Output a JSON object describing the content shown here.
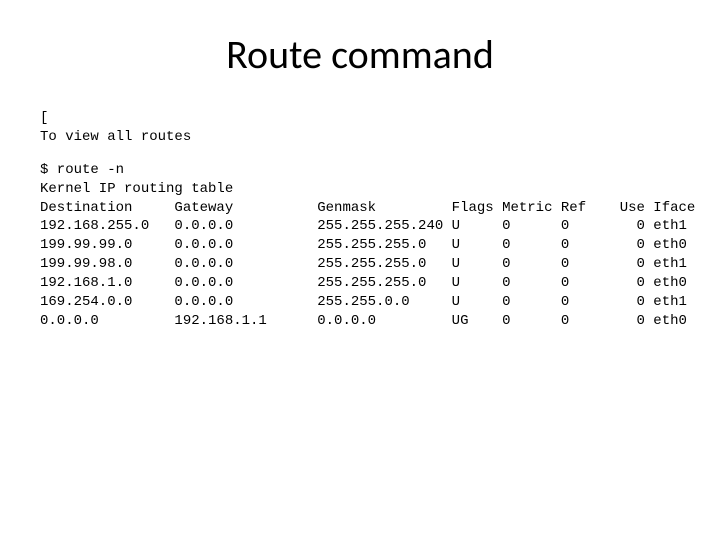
{
  "title": "Route command",
  "intro_bracket": "[",
  "intro_line": "To view all routes",
  "command": "$ route -n",
  "table_title": "Kernel IP routing table",
  "columns": {
    "dest": "Destination",
    "gw": "Gateway",
    "gen": "Genmask",
    "flags": "Flags",
    "metric": "Metric",
    "ref": "Ref",
    "use": "Use",
    "iface": "Iface"
  },
  "rows": [
    {
      "dest": "192.168.255.0",
      "gw": "0.0.0.0",
      "gen": "255.255.255.240",
      "flags": "U",
      "metric": "0",
      "ref": "0",
      "use": "0",
      "iface": "eth1"
    },
    {
      "dest": "199.99.99.0",
      "gw": "0.0.0.0",
      "gen": "255.255.255.0",
      "flags": "U",
      "metric": "0",
      "ref": "0",
      "use": "0",
      "iface": "eth0"
    },
    {
      "dest": "199.99.98.0",
      "gw": "0.0.0.0",
      "gen": "255.255.255.0",
      "flags": "U",
      "metric": "0",
      "ref": "0",
      "use": "0",
      "iface": "eth1"
    },
    {
      "dest": "192.168.1.0",
      "gw": "0.0.0.0",
      "gen": "255.255.255.0",
      "flags": "U",
      "metric": "0",
      "ref": "0",
      "use": "0",
      "iface": "eth0"
    },
    {
      "dest": "169.254.0.0",
      "gw": "0.0.0.0",
      "gen": "255.255.0.0",
      "flags": "U",
      "metric": "0",
      "ref": "0",
      "use": "0",
      "iface": "eth1"
    },
    {
      "dest": "0.0.0.0",
      "gw": "192.168.1.1",
      "gen": "0.0.0.0",
      "flags": "UG",
      "metric": "0",
      "ref": "0",
      "use": "0",
      "iface": "eth0"
    }
  ],
  "col_widths": {
    "dest": 16,
    "gw": 17,
    "gen": 16,
    "flags": 6,
    "metric": 7,
    "ref": 4,
    "use": 6,
    "iface": 6
  }
}
